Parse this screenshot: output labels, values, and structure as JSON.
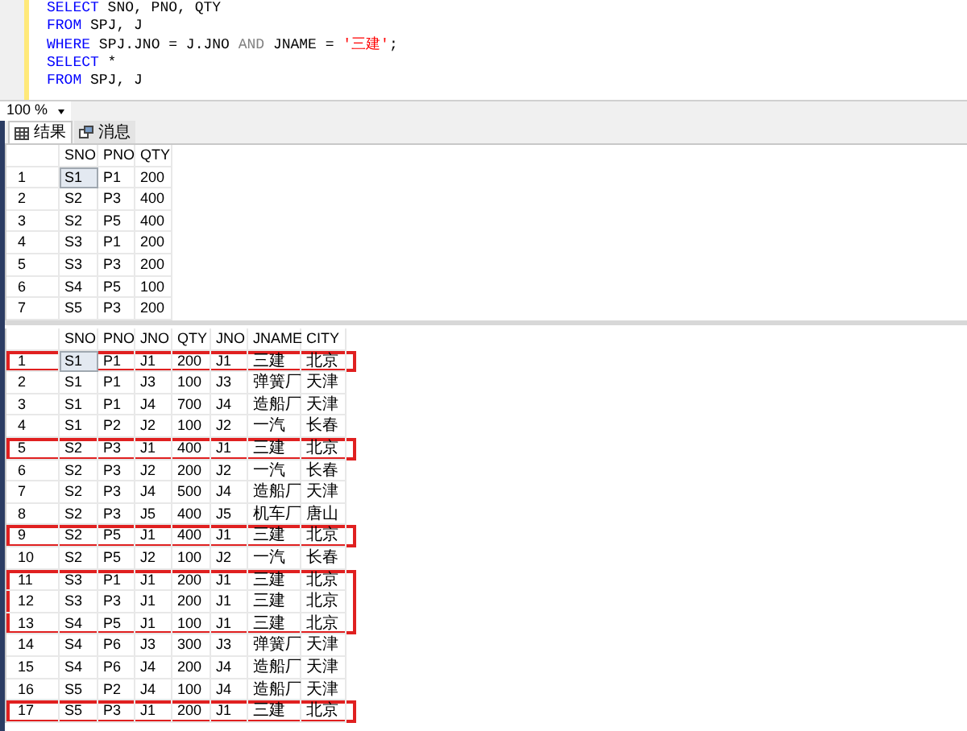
{
  "editor": {
    "lines": [
      [
        {
          "kind": "keyword",
          "text": "SELECT"
        },
        {
          "kind": "plain",
          "text": " SNO, PNO, QTY"
        }
      ],
      [
        {
          "kind": "keyword",
          "text": "FROM"
        },
        {
          "kind": "plain",
          "text": " SPJ, J"
        }
      ],
      [
        {
          "kind": "keyword",
          "text": "WHERE"
        },
        {
          "kind": "plain",
          "text": " SPJ.JNO = J.JNO "
        },
        {
          "kind": "operator",
          "text": "AND"
        },
        {
          "kind": "plain",
          "text": " JNAME = "
        },
        {
          "kind": "string",
          "text": "'三建'"
        },
        {
          "kind": "plain",
          "text": ";"
        }
      ],
      [
        {
          "kind": "keyword",
          "text": "SELECT"
        },
        {
          "kind": "plain",
          "text": " *"
        }
      ],
      [
        {
          "kind": "keyword",
          "text": "FROM"
        },
        {
          "kind": "plain",
          "text": " SPJ, J"
        }
      ]
    ]
  },
  "zoom": {
    "value": "100 %"
  },
  "tabs": [
    {
      "label": "结果",
      "selected": true
    },
    {
      "label": "消息",
      "selected": false
    }
  ],
  "grids": [
    {
      "columns": [
        "SNO",
        "PNO",
        "QTY"
      ],
      "rows": [
        {
          "num": "1",
          "cells": [
            "S1",
            "P1",
            "200"
          ],
          "highlighted": false
        },
        {
          "num": "2",
          "cells": [
            "S2",
            "P3",
            "400"
          ],
          "highlighted": false
        },
        {
          "num": "3",
          "cells": [
            "S2",
            "P5",
            "400"
          ],
          "highlighted": false
        },
        {
          "num": "4",
          "cells": [
            "S3",
            "P1",
            "200"
          ],
          "highlighted": false
        },
        {
          "num": "5",
          "cells": [
            "S3",
            "P3",
            "200"
          ],
          "highlighted": false
        },
        {
          "num": "6",
          "cells": [
            "S4",
            "P5",
            "100"
          ],
          "highlighted": false
        },
        {
          "num": "7",
          "cells": [
            "S5",
            "P3",
            "200"
          ],
          "highlighted": false
        }
      ]
    },
    {
      "columns": [
        "SNO",
        "PNO",
        "JNO",
        "QTY",
        "JNO",
        "JNAME",
        "CITY"
      ],
      "rows": [
        {
          "num": "1",
          "cells": [
            "S1",
            "P1",
            "J1",
            "200",
            "J1",
            "三建",
            "北京"
          ],
          "highlighted": true
        },
        {
          "num": "2",
          "cells": [
            "S1",
            "P1",
            "J3",
            "100",
            "J3",
            "弹簧厂",
            "天津"
          ],
          "highlighted": false
        },
        {
          "num": "3",
          "cells": [
            "S1",
            "P1",
            "J4",
            "700",
            "J4",
            "造船厂",
            "天津"
          ],
          "highlighted": false
        },
        {
          "num": "4",
          "cells": [
            "S1",
            "P2",
            "J2",
            "100",
            "J2",
            "一汽",
            "长春"
          ],
          "highlighted": false
        },
        {
          "num": "5",
          "cells": [
            "S2",
            "P3",
            "J1",
            "400",
            "J1",
            "三建",
            "北京"
          ],
          "highlighted": true
        },
        {
          "num": "6",
          "cells": [
            "S2",
            "P3",
            "J2",
            "200",
            "J2",
            "一汽",
            "长春"
          ],
          "highlighted": false
        },
        {
          "num": "7",
          "cells": [
            "S2",
            "P3",
            "J4",
            "500",
            "J4",
            "造船厂",
            "天津"
          ],
          "highlighted": false
        },
        {
          "num": "8",
          "cells": [
            "S2",
            "P3",
            "J5",
            "400",
            "J5",
            "机车厂",
            "唐山"
          ],
          "highlighted": false
        },
        {
          "num": "9",
          "cells": [
            "S2",
            "P5",
            "J1",
            "400",
            "J1",
            "三建",
            "北京"
          ],
          "highlighted": true
        },
        {
          "num": "10",
          "cells": [
            "S2",
            "P5",
            "J2",
            "100",
            "J2",
            "一汽",
            "长春"
          ],
          "highlighted": false
        },
        {
          "num": "11",
          "cells": [
            "S3",
            "P1",
            "J1",
            "200",
            "J1",
            "三建",
            "北京"
          ],
          "highlighted": true
        },
        {
          "num": "12",
          "cells": [
            "S3",
            "P3",
            "J1",
            "200",
            "J1",
            "三建",
            "北京"
          ],
          "highlighted": true
        },
        {
          "num": "13",
          "cells": [
            "S4",
            "P5",
            "J1",
            "100",
            "J1",
            "三建",
            "北京"
          ],
          "highlighted": true
        },
        {
          "num": "14",
          "cells": [
            "S4",
            "P6",
            "J3",
            "300",
            "J3",
            "弹簧厂",
            "天津"
          ],
          "highlighted": false
        },
        {
          "num": "15",
          "cells": [
            "S4",
            "P6",
            "J4",
            "200",
            "J4",
            "造船厂",
            "天津"
          ],
          "highlighted": false
        },
        {
          "num": "16",
          "cells": [
            "S5",
            "P2",
            "J4",
            "100",
            "J4",
            "造船厂",
            "天津"
          ],
          "highlighted": false
        },
        {
          "num": "17",
          "cells": [
            "S5",
            "P3",
            "J1",
            "200",
            "J1",
            "三建",
            "北京"
          ],
          "highlighted": true
        }
      ]
    }
  ]
}
